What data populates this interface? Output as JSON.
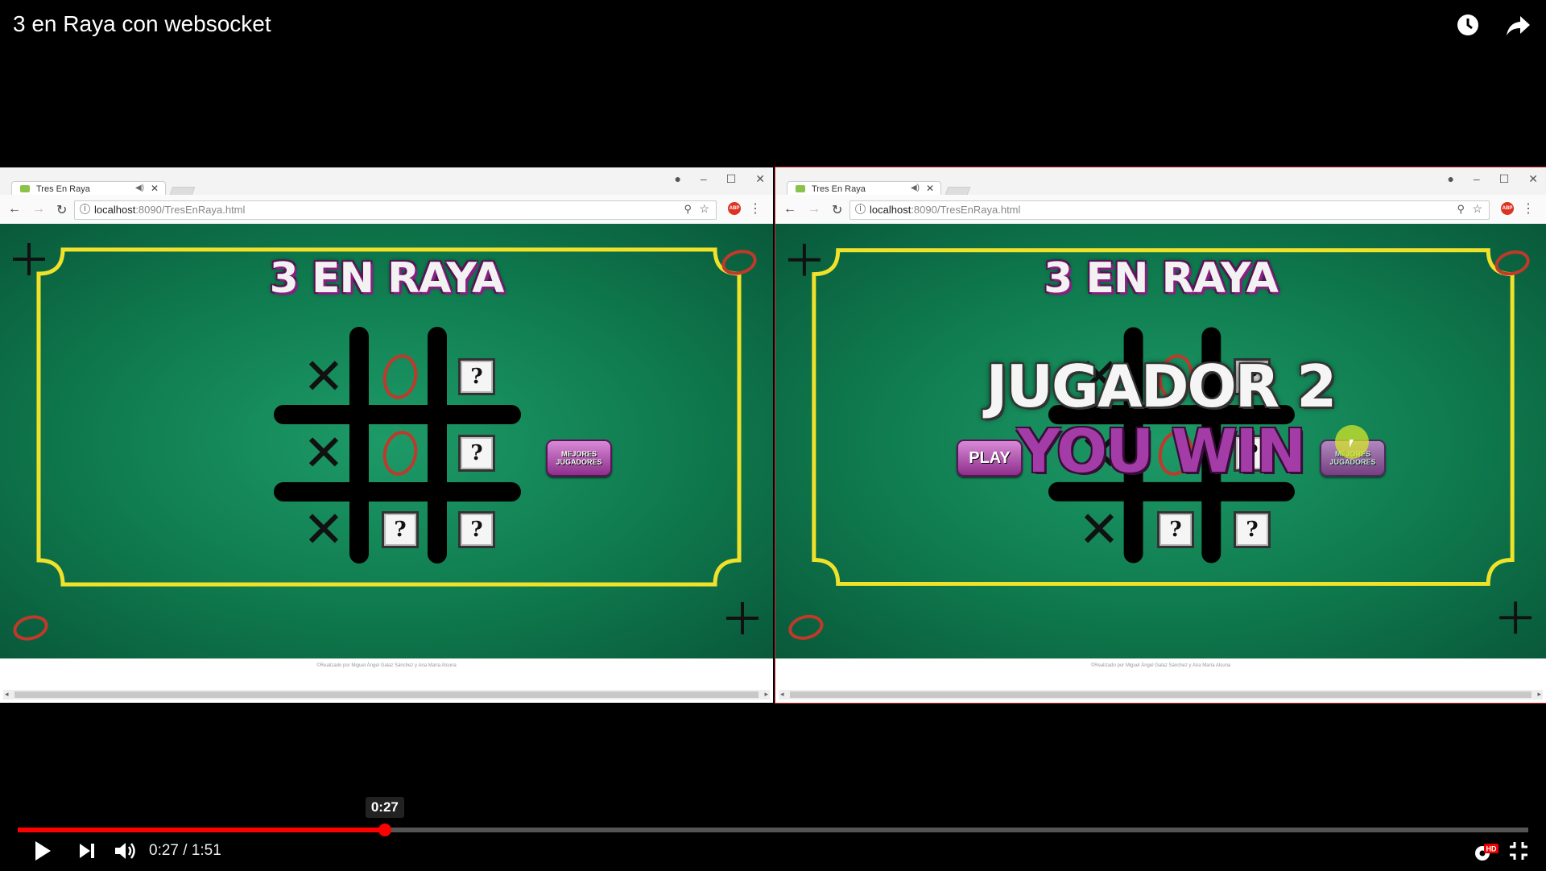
{
  "video": {
    "title": "3 en Raya con websocket",
    "icons": [
      "watch-later-icon",
      "share-icon"
    ]
  },
  "windows": [
    {
      "tab_title": "Tres En Raya",
      "url_host": "localhost",
      "url_rest": ":8090/TresEnRaya.html",
      "game": {
        "title": "3 EN RAYA",
        "board": [
          "X",
          "O",
          "?",
          "X",
          "O",
          "?",
          "X",
          "?",
          "?"
        ],
        "button_ranking": "MEJORES\nJUGADORES"
      },
      "credit": "©Realizado por Miguel Ángel Galaz Sánchez y Ana María Alsuna"
    },
    {
      "tab_title": "Tres En Raya",
      "url_host": "localhost",
      "url_rest": ":8090/TresEnRaya.html",
      "game": {
        "title": "3 EN RAYA",
        "board": [
          "X",
          "O",
          "?",
          "X",
          "O",
          "?",
          "X",
          "?",
          "?"
        ],
        "overlay_line1": "JUGADOR 2",
        "overlay_line2": "YOU WIN",
        "button_play": "PLAY",
        "button_ranking": "MEJORES\nJUGADORES"
      },
      "credit": "©Realizado por Miguel Ángel Galaz Sánchez y Ana María Alsuna"
    }
  ],
  "player": {
    "hover_time": "0:27",
    "current_time": "0:27",
    "duration": "1:51",
    "time_display": "0:27 / 1:51",
    "progress_fraction": 0.243,
    "hd_label": "HD",
    "played_color": "#ff0000"
  },
  "colors": {
    "felt": "#0f7a4e",
    "frame": "#f0e22a",
    "o_mark": "#c0392b",
    "button": "#a64aa4"
  }
}
